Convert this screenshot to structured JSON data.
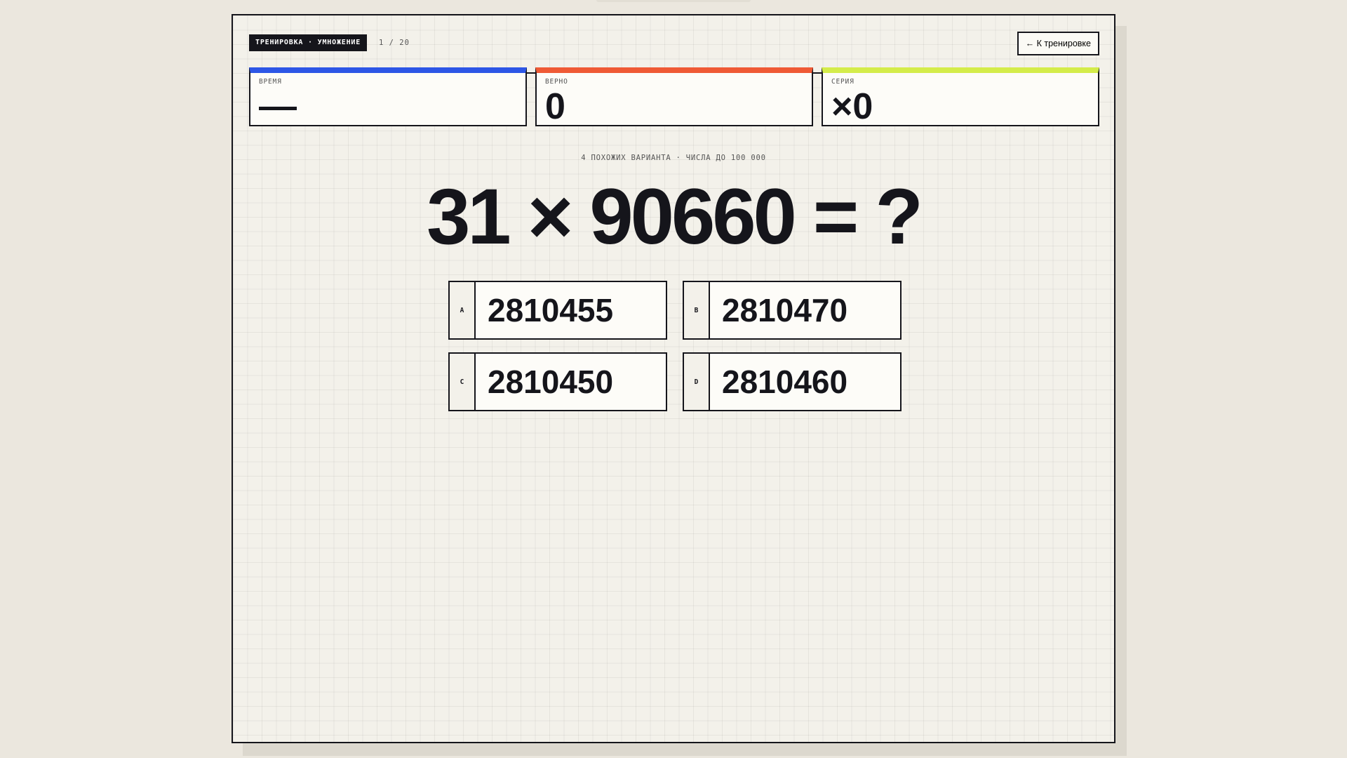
{
  "header": {
    "mode_label": "ТРЕНИРОВКА · УМНОЖЕНИЕ",
    "progress": "1 / 20",
    "back_label": "← К тренировке"
  },
  "stats": {
    "time": {
      "label": "ВРЕМЯ",
      "value": ""
    },
    "correct": {
      "label": "ВЕРНО",
      "value": "0"
    },
    "streak": {
      "label": "СЕРИЯ",
      "value": "×0"
    }
  },
  "quiz": {
    "hint": "4 ПОХОЖИХ ВАРИАНТА · ЧИСЛА ДО 100 000",
    "question": "31 × 90660 = ?",
    "answers": [
      {
        "letter": "A",
        "value": "2810455"
      },
      {
        "letter": "B",
        "value": "2810470"
      },
      {
        "letter": "C",
        "value": "2810450"
      },
      {
        "letter": "D",
        "value": "2810460"
      }
    ]
  },
  "colors": {
    "time_accent": "#2d56e6",
    "correct_accent": "#ef5a35",
    "streak_accent": "#d4ec4a",
    "ink": "#15151b",
    "paper": "#f3f1ea"
  }
}
